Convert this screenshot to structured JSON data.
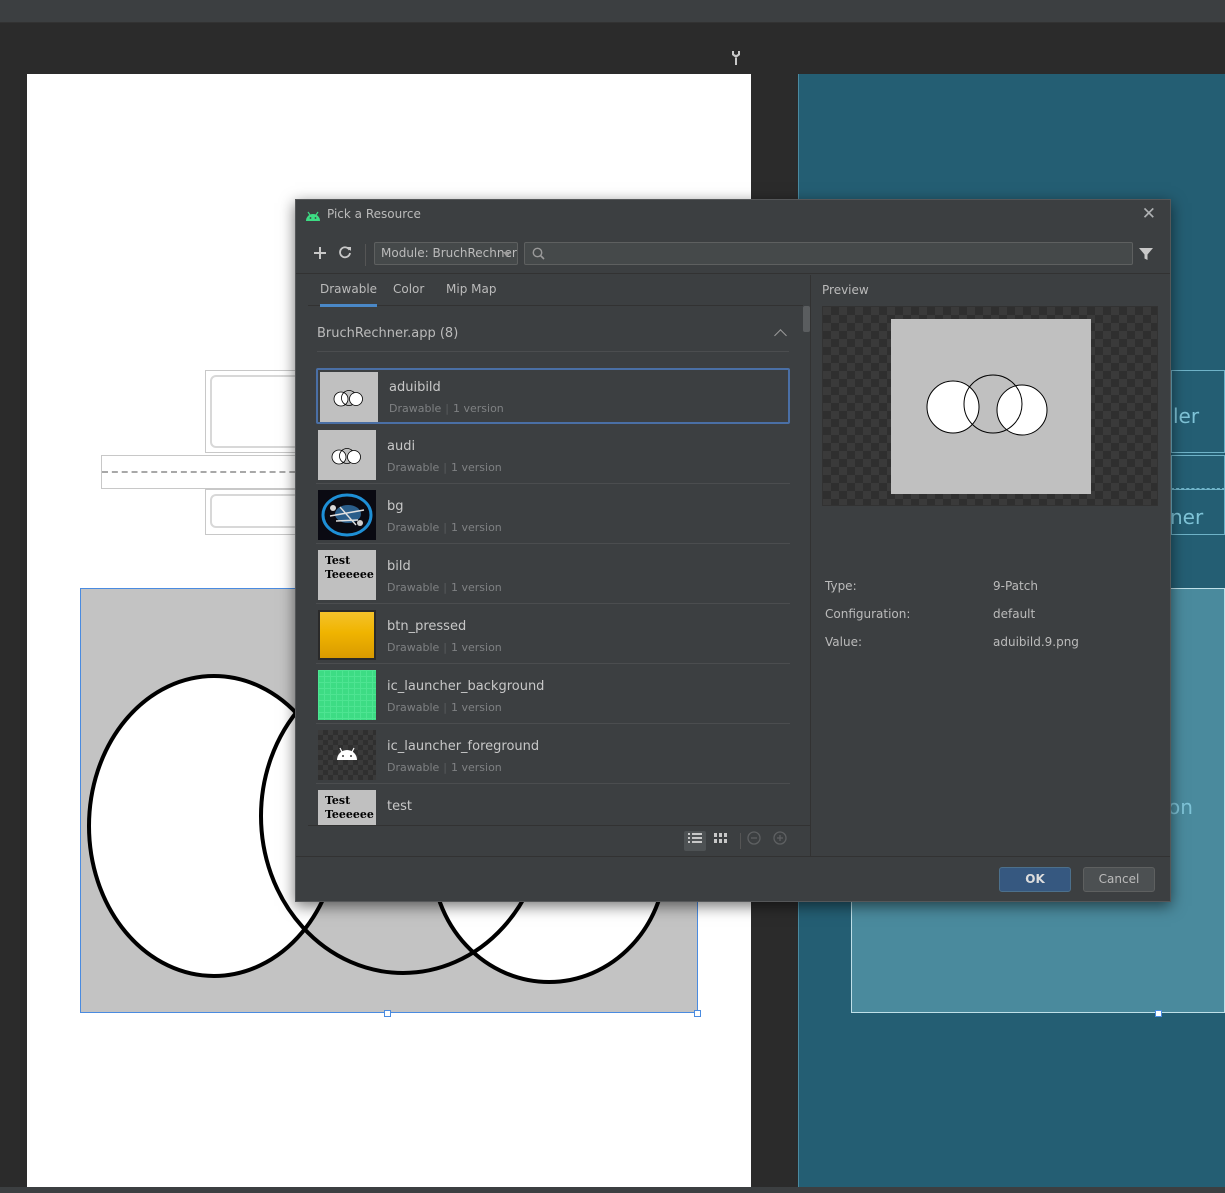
{
  "dialog": {
    "title": "Pick a Resource",
    "module_select": "Module: BruchRechner",
    "search_placeholder": "",
    "tabs": [
      {
        "label": "Drawable",
        "active": true
      },
      {
        "label": "Color",
        "active": false
      },
      {
        "label": "Mip Map",
        "active": false
      }
    ],
    "group_header": "BruchRechner.app (8)",
    "resources": [
      {
        "name": "aduibild",
        "type": "Drawable",
        "versions": "1 version",
        "selected": true
      },
      {
        "name": "audi",
        "type": "Drawable",
        "versions": "1 version"
      },
      {
        "name": "bg",
        "type": "Drawable",
        "versions": "1 version"
      },
      {
        "name": "bild",
        "type": "Drawable",
        "versions": "1 version",
        "thumb_text": [
          "Test",
          "Teeeeee"
        ]
      },
      {
        "name": "btn_pressed",
        "type": "Drawable",
        "versions": "1 version"
      },
      {
        "name": "ic_launcher_background",
        "type": "Drawable",
        "versions": "1 version"
      },
      {
        "name": "ic_launcher_foreground",
        "type": "Drawable",
        "versions": "1 version"
      },
      {
        "name": "test",
        "type": "Drawable",
        "versions": "",
        "thumb_text": [
          "Test",
          "Teeeeee"
        ]
      }
    ],
    "preview": {
      "label": "Preview",
      "properties": [
        {
          "label": "Type:",
          "value": "9-Patch"
        },
        {
          "label": "Configuration:",
          "value": "default"
        },
        {
          "label": "Value:",
          "value": "aduibild.9.png"
        }
      ]
    },
    "ok_label": "OK",
    "cancel_label": "Cancel"
  },
  "blueprint": {
    "text_1": "ler",
    "text_2": "ner",
    "text_3": "on"
  },
  "colors": {
    "accent": "#4a88c7",
    "ok_button": "#365880",
    "blueprint_bg": "#245e73",
    "android_green": "#3ddc84"
  },
  "icons": {
    "add": "plus-icon",
    "refresh": "refresh-icon",
    "search": "search-icon",
    "filter": "filter-icon",
    "close": "close-icon",
    "collapse": "chevron-up-icon",
    "list_view": "list-view-icon",
    "grid_view": "grid-view-icon",
    "zoom_out": "zoom-out-icon",
    "zoom_in": "zoom-in-icon",
    "wrench": "wrench-icon"
  }
}
